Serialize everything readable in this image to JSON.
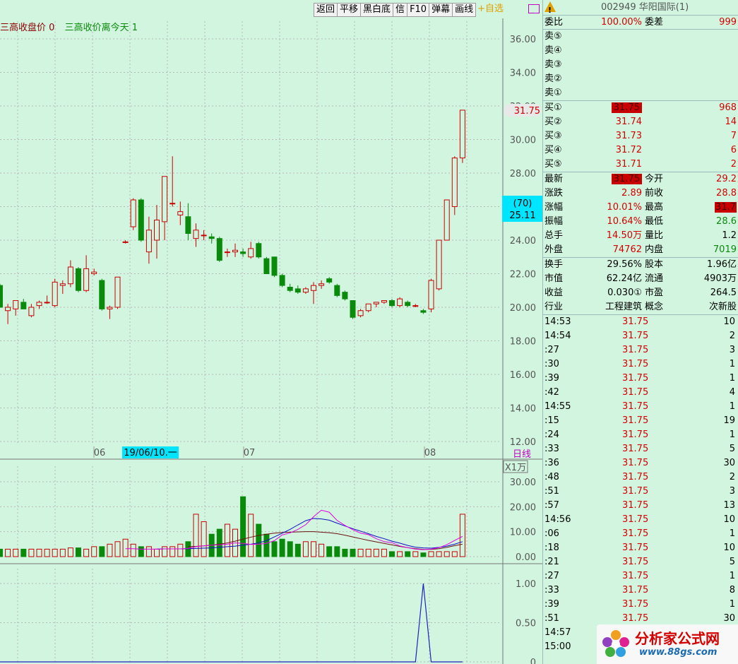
{
  "toolbar": {
    "buttons": [
      "返回",
      "平移",
      "黑白底",
      "信",
      "F10",
      "弹幕",
      "画线"
    ],
    "zixuan": "+自选"
  },
  "legend": {
    "name1": "三高收盘价",
    "val1": "0",
    "name2": "三高收价离今天",
    "val2": "1"
  },
  "main_axis": {
    "labels": [
      "36.00",
      "34.00",
      "32.00",
      "30.00",
      "28.00",
      "26.00",
      "24.00",
      "22.00",
      "20.00",
      "18.00",
      "16.00",
      "14.00",
      "12.00"
    ],
    "current_price": "31.75",
    "cursor_top": "(70)",
    "cursor_bottom": "25.11"
  },
  "time_axis": {
    "months": [
      "06",
      "07",
      "08"
    ],
    "cursor_date": "19/06/10.一",
    "period": "日线"
  },
  "volume_axis": {
    "unit": "X1万",
    "labels": [
      "30.00",
      "20.00",
      "10.00",
      "0.00"
    ]
  },
  "indicator_axis": {
    "labels": [
      "1.00",
      "0.50",
      "0"
    ]
  },
  "chart_data": {
    "type": "candlestick",
    "candles": [
      {
        "o": 21.3,
        "h": 21.4,
        "l": 20.0,
        "c": 20.0
      },
      {
        "o": 19.8,
        "h": 20.2,
        "l": 19.0,
        "c": 20.0
      },
      {
        "o": 19.9,
        "h": 20.4,
        "l": 19.5,
        "c": 20.4
      },
      {
        "o": 20.3,
        "h": 20.5,
        "l": 19.9,
        "c": 19.9
      },
      {
        "o": 19.5,
        "h": 20.2,
        "l": 19.4,
        "c": 20.0
      },
      {
        "o": 20.1,
        "h": 20.4,
        "l": 19.9,
        "c": 20.3
      },
      {
        "o": 20.3,
        "h": 20.7,
        "l": 20.2,
        "c": 20.3
      },
      {
        "o": 20.1,
        "h": 21.7,
        "l": 20.0,
        "c": 21.5
      },
      {
        "o": 21.3,
        "h": 21.6,
        "l": 20.8,
        "c": 21.4
      },
      {
        "o": 21.4,
        "h": 22.8,
        "l": 21.2,
        "c": 22.4
      },
      {
        "o": 22.3,
        "h": 22.4,
        "l": 20.9,
        "c": 21.0
      },
      {
        "o": 21.0,
        "h": 23.1,
        "l": 20.9,
        "c": 22.3
      },
      {
        "o": 22.0,
        "h": 22.3,
        "l": 21.9,
        "c": 22.1
      },
      {
        "o": 21.6,
        "h": 21.7,
        "l": 19.8,
        "c": 19.9
      },
      {
        "o": 19.9,
        "h": 20.1,
        "l": 19.3,
        "c": 20.0
      },
      {
        "o": 20.0,
        "h": 21.8,
        "l": 19.9,
        "c": 21.8
      },
      {
        "o": 23.9,
        "h": 24.0,
        "l": 23.8,
        "c": 23.9
      },
      {
        "o": 24.8,
        "h": 26.5,
        "l": 24.6,
        "c": 26.4
      },
      {
        "o": 26.4,
        "h": 26.5,
        "l": 23.9,
        "c": 24.0
      },
      {
        "o": 23.3,
        "h": 25.4,
        "l": 22.6,
        "c": 24.6
      },
      {
        "o": 24.0,
        "h": 26.1,
        "l": 22.9,
        "c": 25.2
      },
      {
        "o": 25.1,
        "h": 27.8,
        "l": 24.0,
        "c": 27.8
      },
      {
        "o": 26.2,
        "h": 29.0,
        "l": 26.0,
        "c": 26.2
      },
      {
        "o": 25.5,
        "h": 26.3,
        "l": 24.9,
        "c": 25.7
      },
      {
        "o": 25.4,
        "h": 26.2,
        "l": 24.0,
        "c": 24.4
      },
      {
        "o": 24.1,
        "h": 25.0,
        "l": 23.6,
        "c": 24.6
      },
      {
        "o": 24.3,
        "h": 24.6,
        "l": 24.0,
        "c": 24.3
      },
      {
        "o": 24.2,
        "h": 24.4,
        "l": 23.8,
        "c": 24.1
      },
      {
        "o": 24.1,
        "h": 24.2,
        "l": 22.7,
        "c": 22.8
      },
      {
        "o": 23.3,
        "h": 23.5,
        "l": 23.0,
        "c": 23.3
      },
      {
        "o": 23.3,
        "h": 23.8,
        "l": 23.0,
        "c": 23.4
      },
      {
        "o": 23.3,
        "h": 23.5,
        "l": 23.0,
        "c": 23.2
      },
      {
        "o": 23.0,
        "h": 23.9,
        "l": 22.9,
        "c": 23.5
      },
      {
        "o": 23.8,
        "h": 23.9,
        "l": 22.9,
        "c": 23.0
      },
      {
        "o": 22.9,
        "h": 23.0,
        "l": 22.0,
        "c": 22.0
      },
      {
        "o": 23.0,
        "h": 23.0,
        "l": 21.8,
        "c": 21.9
      },
      {
        "o": 21.9,
        "h": 22.0,
        "l": 21.2,
        "c": 21.3
      },
      {
        "o": 21.2,
        "h": 21.4,
        "l": 20.9,
        "c": 21.0
      },
      {
        "o": 21.1,
        "h": 21.3,
        "l": 20.8,
        "c": 20.9
      },
      {
        "o": 20.9,
        "h": 21.2,
        "l": 20.8,
        "c": 21.1
      },
      {
        "o": 21.0,
        "h": 21.5,
        "l": 20.2,
        "c": 21.3
      },
      {
        "o": 21.3,
        "h": 21.6,
        "l": 21.1,
        "c": 21.4
      },
      {
        "o": 21.7,
        "h": 21.8,
        "l": 21.4,
        "c": 21.5
      },
      {
        "o": 21.3,
        "h": 21.4,
        "l": 20.6,
        "c": 20.7
      },
      {
        "o": 20.9,
        "h": 21.0,
        "l": 20.4,
        "c": 20.5
      },
      {
        "o": 20.4,
        "h": 20.4,
        "l": 19.3,
        "c": 19.4
      },
      {
        "o": 19.5,
        "h": 19.9,
        "l": 19.4,
        "c": 19.8
      },
      {
        "o": 19.8,
        "h": 20.2,
        "l": 19.7,
        "c": 20.2
      },
      {
        "o": 20.2,
        "h": 20.3,
        "l": 20.0,
        "c": 20.3
      },
      {
        "o": 20.3,
        "h": 20.4,
        "l": 20.2,
        "c": 20.4
      },
      {
        "o": 20.4,
        "h": 20.5,
        "l": 20.0,
        "c": 20.1
      },
      {
        "o": 20.1,
        "h": 20.6,
        "l": 20.0,
        "c": 20.5
      },
      {
        "o": 20.3,
        "h": 20.4,
        "l": 20.0,
        "c": 20.1
      },
      {
        "o": 20.1,
        "h": 20.2,
        "l": 20.0,
        "c": 20.1
      },
      {
        "o": 19.8,
        "h": 19.9,
        "l": 19.6,
        "c": 19.7
      },
      {
        "o": 19.9,
        "h": 21.7,
        "l": 19.7,
        "c": 21.6
      },
      {
        "o": 21.1,
        "h": 24.0,
        "l": 21.0,
        "c": 24.0
      },
      {
        "o": 24.0,
        "h": 26.4,
        "l": 24.0,
        "c": 26.4
      },
      {
        "o": 26.0,
        "h": 29.0,
        "l": 25.5,
        "c": 28.9
      },
      {
        "o": 28.9,
        "h": 31.75,
        "l": 28.6,
        "c": 31.75
      }
    ],
    "volume": [
      3,
      3,
      3,
      3,
      3,
      3,
      3,
      3,
      3,
      3.5,
      3.5,
      3,
      4,
      4,
      5,
      6,
      7,
      5,
      4,
      4,
      3,
      4,
      4,
      5,
      6,
      17,
      14,
      9,
      11,
      13,
      11,
      24,
      17,
      13,
      9,
      6,
      7,
      6,
      5,
      6,
      6,
      5,
      4,
      4,
      3,
      3,
      3,
      3,
      3,
      3,
      2,
      2,
      2,
      2,
      1.5,
      2,
      2,
      2,
      2,
      17
    ],
    "vol_ma": {
      "ma5": [
        3.2,
        3.2,
        3.0,
        3.0,
        3.0,
        3.1,
        3.1,
        3.1,
        3.3,
        4.0,
        4.3,
        4.6,
        4.7,
        5.0,
        5.5,
        5.3,
        4.9,
        5.0,
        5.3,
        6.4,
        8.7,
        9.5,
        10.9,
        12.8,
        16.0,
        18.6,
        17.8,
        14.5,
        12.5,
        10.8,
        9.4,
        8.8,
        7.2,
        6.0,
        5.6,
        4.3,
        3.6,
        3.0,
        2.8,
        3.0,
        3.6,
        4.8,
        6.5,
        8.1
      ],
      "ma10": [
        3.0,
        3.1,
        3.1,
        3.1,
        3.2,
        3.3,
        3.4,
        3.5,
        3.7,
        4.0,
        4.2,
        4.6,
        5.0,
        5.5,
        6.4,
        7.9,
        9.4,
        10.9,
        12.7,
        14.4,
        15.3,
        15.1,
        14.6,
        13.4,
        12.3,
        11.2,
        10.2,
        9.2,
        8.1,
        7.2,
        6.2,
        5.4,
        4.5,
        3.8,
        3.5,
        3.4,
        3.7,
        4.2,
        5.0,
        6.0
      ],
      "ma20": [
        4.0,
        4.1,
        4.3,
        4.6,
        5.0,
        5.5,
        6.2,
        7.0,
        7.8,
        8.5,
        9.0,
        9.4,
        9.7,
        9.8,
        9.9,
        10.0,
        10.0,
        9.8,
        9.6,
        9.2,
        8.6,
        7.9,
        7.2,
        6.5,
        5.9,
        5.3,
        4.7,
        4.1,
        3.6,
        3.2,
        2.9,
        2.9,
        3.2,
        3.7,
        4.4,
        5.0
      ]
    },
    "signal": [
      0,
      0,
      0,
      0,
      0,
      0,
      0,
      0,
      0,
      0,
      0,
      0,
      0,
      0,
      0,
      0,
      0,
      0,
      0,
      0,
      0,
      0,
      0,
      0,
      0,
      0,
      0,
      0,
      0,
      0,
      0,
      0,
      0,
      0,
      0,
      0,
      0,
      0,
      0,
      0,
      0,
      0,
      0,
      0,
      0,
      0,
      0,
      0,
      0,
      0,
      0,
      0,
      0,
      0,
      1,
      0,
      0,
      0,
      0,
      0
    ],
    "price_ylim": [
      12,
      37
    ],
    "volume_ylim": [
      0,
      30
    ],
    "signal_ylim": [
      0,
      1
    ]
  },
  "panel": {
    "title": "002949 华阳国际(1)",
    "weibi_label": "委比",
    "weibi_val": "100.00%",
    "weicha_label": "委差",
    "weicha_val": "999",
    "sell": [
      {
        "label": "卖⑤"
      },
      {
        "label": "卖④"
      },
      {
        "label": "卖③"
      },
      {
        "label": "卖②"
      },
      {
        "label": "卖①"
      }
    ],
    "buy": [
      {
        "label": "买①",
        "price": "31.75",
        "vol": "968"
      },
      {
        "label": "买②",
        "price": "31.74",
        "vol": "14"
      },
      {
        "label": "买③",
        "price": "31.73",
        "vol": "7"
      },
      {
        "label": "买④",
        "price": "31.72",
        "vol": "6"
      },
      {
        "label": "买⑤",
        "price": "31.71",
        "vol": "2"
      }
    ],
    "quote": [
      {
        "l1": "最新",
        "v1": "31.75",
        "l2": "今开",
        "v2": "29.2"
      },
      {
        "l1": "涨跌",
        "v1": "2.89",
        "l2": "前收",
        "v2": "28.8"
      },
      {
        "l1": "涨幅",
        "v1": "10.01%",
        "l2": "最高",
        "v2": "31.7"
      },
      {
        "l1": "振幅",
        "v1": "10.64%",
        "l2": "最低",
        "v2": "28.6"
      },
      {
        "l1": "总手",
        "v1": "14.50万",
        "l2": "量比",
        "v2": "1.2"
      },
      {
        "l1": "外盘",
        "v1": "74762",
        "l2": "内盘",
        "v2": "7019"
      }
    ],
    "info": [
      {
        "l1": "换手",
        "v1": "29.56%",
        "l2": "股本",
        "v2": "1.96亿"
      },
      {
        "l1": "市值",
        "v1": "62.24亿",
        "l2": "流通",
        "v2": "4903万"
      },
      {
        "l1": "收益",
        "v1": "0.030①",
        "l2": "市盈",
        "v2": "264.5"
      },
      {
        "l1": "行业",
        "v1": "工程建筑",
        "l2": "概念",
        "v2": "次新股"
      }
    ],
    "trades": [
      {
        "t": "14:53",
        "p": "31.75",
        "v": "10"
      },
      {
        "t": "14:54",
        "p": "31.75",
        "v": "2"
      },
      {
        "t": ":27",
        "p": "31.75",
        "v": "3"
      },
      {
        "t": ":30",
        "p": "31.75",
        "v": "1"
      },
      {
        "t": ":39",
        "p": "31.75",
        "v": "1"
      },
      {
        "t": ":42",
        "p": "31.75",
        "v": "4"
      },
      {
        "t": "14:55",
        "p": "31.75",
        "v": "1"
      },
      {
        "t": ":15",
        "p": "31.75",
        "v": "19"
      },
      {
        "t": ":24",
        "p": "31.75",
        "v": "1"
      },
      {
        "t": ":33",
        "p": "31.75",
        "v": "5"
      },
      {
        "t": ":36",
        "p": "31.75",
        "v": "30"
      },
      {
        "t": ":48",
        "p": "31.75",
        "v": "2"
      },
      {
        "t": ":51",
        "p": "31.75",
        "v": "3"
      },
      {
        "t": ":57",
        "p": "31.75",
        "v": "13"
      },
      {
        "t": "14:56",
        "p": "31.75",
        "v": "10"
      },
      {
        "t": ":06",
        "p": "31.75",
        "v": "1"
      },
      {
        "t": ":18",
        "p": "31.75",
        "v": "10"
      },
      {
        "t": ":21",
        "p": "31.75",
        "v": "5"
      },
      {
        "t": ":27",
        "p": "31.75",
        "v": "1"
      },
      {
        "t": ":33",
        "p": "31.75",
        "v": "8"
      },
      {
        "t": ":39",
        "p": "31.75",
        "v": "1"
      },
      {
        "t": ":51",
        "p": "31.75",
        "v": "30"
      },
      {
        "t": "14:57",
        "p": "31.75",
        "v": ""
      },
      {
        "t": "15:00",
        "p": "31.75",
        "v": ""
      }
    ]
  },
  "logo": {
    "brand": "分析家公式网",
    "url": "www.88gs.com"
  },
  "colors": {
    "up": "#c80000",
    "down": "#0a8a0a",
    "bg": "#d2f5e0",
    "grid": "#b8b8b8",
    "ma5": "#e000e0",
    "ma10": "#1010c0",
    "ma20": "#6a1010",
    "signal": "#2020c0"
  }
}
